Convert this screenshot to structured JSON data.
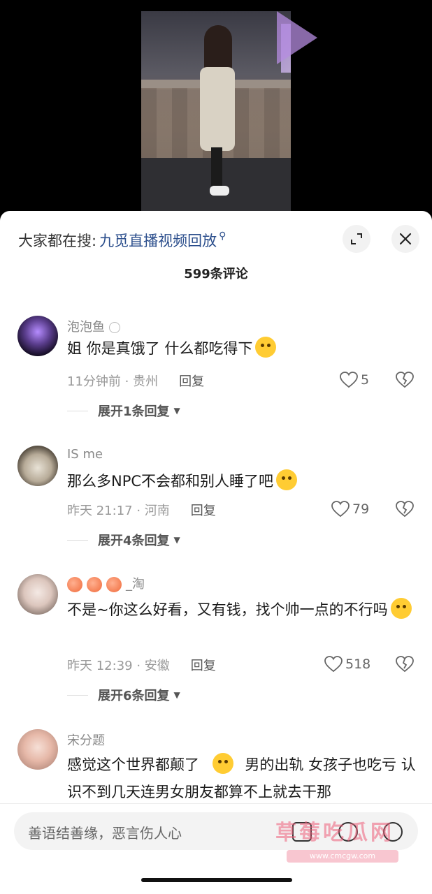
{
  "search": {
    "prefix": "大家都在搜:",
    "link": "九觅直播视频回放",
    "mag": "⚲"
  },
  "comment_count": "599条评论",
  "comments": [
    {
      "username": "泡泡鱼",
      "text": "姐 你是真饿了 什么都吃得下",
      "time_loc": "11分钟前 · 贵州",
      "reply": "回复",
      "likes": "5",
      "expand": "展开1条回复"
    },
    {
      "username": "IS me",
      "text": "那么多NPC不会都和别人睡了吧",
      "time_loc": "昨天 21:17 · 河南",
      "reply": "回复",
      "likes": "79",
      "expand": "展开4条回复"
    },
    {
      "username": "_淘",
      "text": "不是~你这么好看，又有钱，找个帅一点的不行吗",
      "time_loc": "昨天 12:39 · 安徽",
      "reply": "回复",
      "likes": "518",
      "expand": "展开6条回复"
    },
    {
      "username": "宋分题",
      "text_a": "感觉这个世界都颠了",
      "text_b": "男的出轨 女孩子也吃亏 认识不到几天连男女朋友都算不上就去干那"
    }
  ],
  "input": {
    "placeholder": "善语结善缘，恶言伤人心"
  },
  "watermark": {
    "text": "草莓吃瓜网",
    "url": "www.cmcgw.com"
  },
  "colors": {
    "link": "#2b4e8c",
    "meta": "#999999"
  }
}
